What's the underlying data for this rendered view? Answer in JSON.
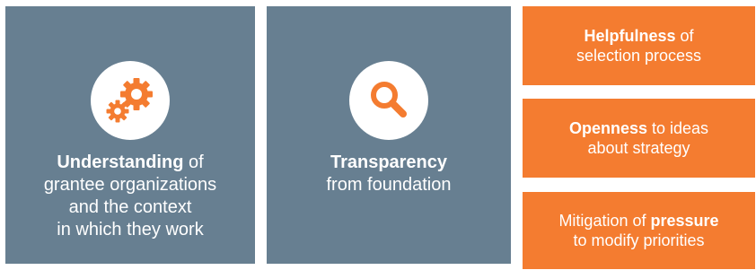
{
  "panels": {
    "understanding": {
      "icon": "gears-icon",
      "bold": "Understanding",
      "line1_rest": " of",
      "line2": "grantee organizations",
      "line3": "and the context",
      "line4": "in which they work"
    },
    "transparency": {
      "icon": "magnifier-icon",
      "bold": "Transparency",
      "line2": "from foundation"
    }
  },
  "boxes": {
    "helpfulness": {
      "bold": "Helpfulness",
      "rest": " of",
      "line2": "selection process"
    },
    "openness": {
      "bold": "Openness",
      "rest": " to ideas",
      "line2": "about strategy"
    },
    "mitigation": {
      "pre": "Mitigation of ",
      "bold": "pressure",
      "line2": "to modify priorities"
    }
  },
  "colors": {
    "panel_gray": "#677f91",
    "accent_orange": "#f47c30",
    "white": "#ffffff"
  }
}
